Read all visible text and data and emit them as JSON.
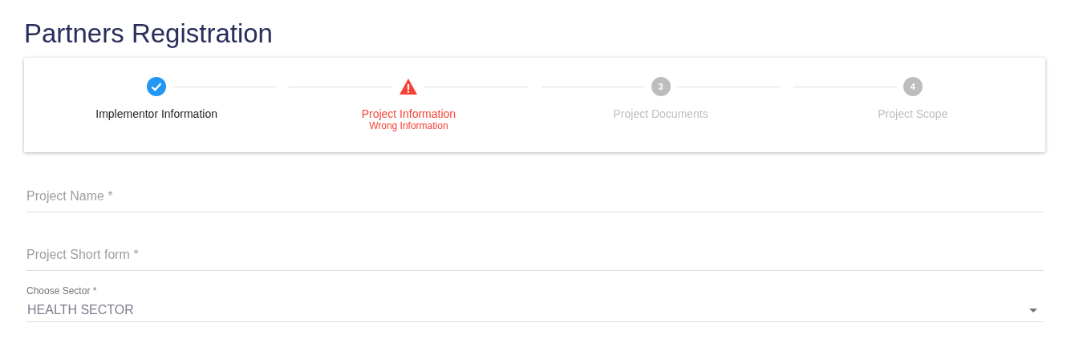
{
  "page_title": "Partners Registration",
  "steps": [
    {
      "kind": "done",
      "label": "Implementor Information"
    },
    {
      "kind": "error",
      "label": "Project Information",
      "error": "Wrong Information"
    },
    {
      "kind": "pending",
      "number": "3",
      "label": "Project Documents"
    },
    {
      "kind": "pending",
      "number": "4",
      "label": "Project Scope"
    }
  ],
  "fields": [
    {
      "kind": "text",
      "placeholder": "Project Name *"
    },
    {
      "kind": "text",
      "placeholder": "Project Short form *"
    },
    {
      "kind": "select",
      "label": "Choose Sector *",
      "value": "HEALTH SECTOR"
    }
  ]
}
